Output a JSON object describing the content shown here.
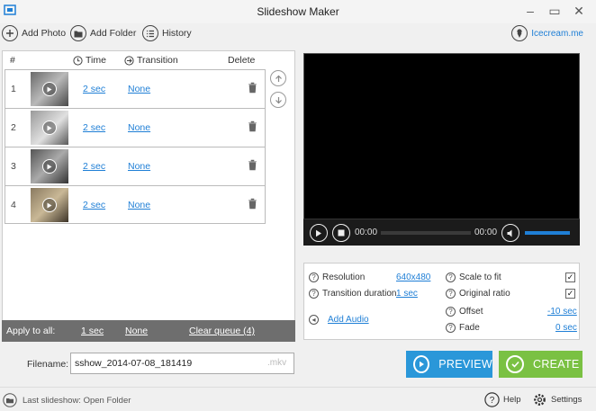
{
  "window": {
    "title": "Slideshow Maker"
  },
  "toolbar": {
    "add_photo": "Add Photo",
    "add_folder": "Add Folder",
    "history": "History",
    "brand_link": "Icecream.me"
  },
  "list": {
    "headers": {
      "num": "#",
      "time": "Time",
      "transition": "Transition",
      "delete": "Delete"
    },
    "rows": [
      {
        "num": "1",
        "time": "2 sec",
        "transition": "None"
      },
      {
        "num": "2",
        "time": "2 sec",
        "transition": "None"
      },
      {
        "num": "3",
        "time": "2 sec",
        "transition": "None"
      },
      {
        "num": "4",
        "time": "2 sec",
        "transition": "None"
      }
    ]
  },
  "apply_bar": {
    "label": "Apply to all:",
    "time": "1 sec",
    "transition": "None",
    "clear_queue": "Clear queue (4)"
  },
  "player": {
    "current_time": "00:00",
    "total_time": "00:00",
    "progress": 0
  },
  "settings": {
    "resolution_label": "Resolution",
    "resolution_value": "640x480",
    "transition_label": "Transition duration",
    "transition_value": "1 sec",
    "add_audio": "Add Audio",
    "scale_label": "Scale to fit",
    "scale_checked": true,
    "ratio_label": "Original ratio",
    "ratio_checked": true,
    "offset_label": "Offset",
    "offset_value": "-10 sec",
    "fade_label": "Fade",
    "fade_value": "0 sec"
  },
  "output": {
    "filename_label": "Filename:",
    "filename_value": "sshow_2014-07-08_181419",
    "extension": ".mkv"
  },
  "actions": {
    "preview": "PREVIEW",
    "create": "CREATE"
  },
  "status": {
    "last_slideshow": "Last slideshow: Open Folder",
    "help": "Help",
    "settings": "Settings"
  },
  "colors": {
    "accent": "#1f7fd6",
    "preview_button": "#2a97d9",
    "create_button": "#7ac143",
    "apply_bar": "#6e6e6e"
  }
}
